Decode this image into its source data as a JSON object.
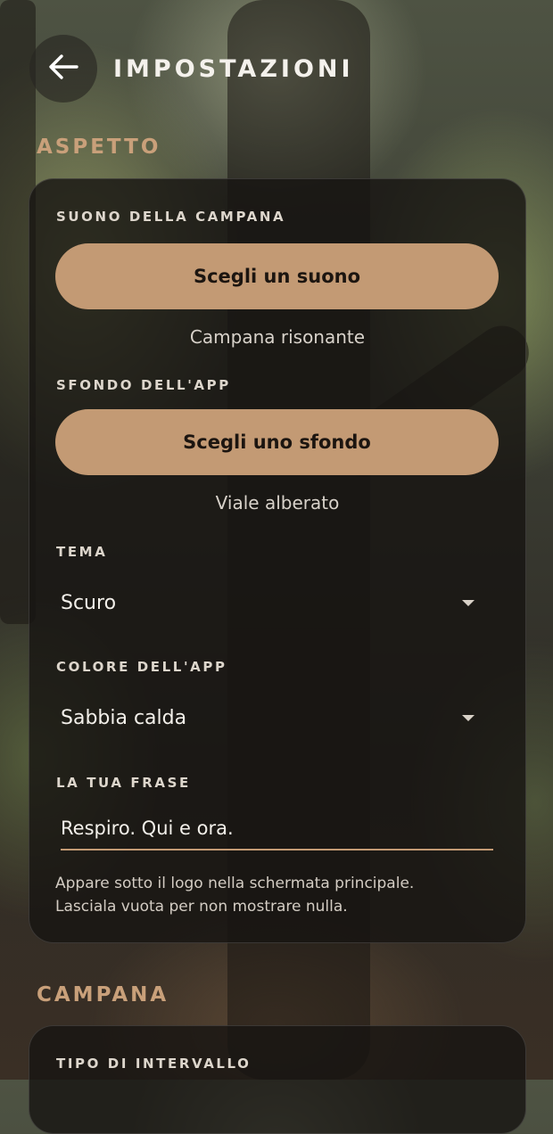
{
  "header": {
    "title": "IMPOSTAZIONI"
  },
  "sections": {
    "aspetto": {
      "title": "ASPETTO",
      "bell_sound": {
        "label": "SUONO DELLA CAMPANA",
        "button": "Scegli un suono",
        "current": "Campana risonante"
      },
      "background": {
        "label": "SFONDO DELL'APP",
        "button": "Scegli uno sfondo",
        "current": "Viale alberato"
      },
      "theme": {
        "label": "TEMA",
        "value": "Scuro"
      },
      "color": {
        "label": "COLORE DELL'APP",
        "value": "Sabbia calda"
      },
      "phrase": {
        "label": "LA TUA FRASE",
        "value": "Respiro. Qui e ora.",
        "helper_line1": "Appare sotto il logo nella schermata principale.",
        "helper_line2": "Lasciala vuota per non mostrare nulla."
      }
    },
    "campana": {
      "title": "CAMPANA",
      "interval_type": {
        "label": "TIPO DI INTERVALLO"
      }
    }
  },
  "colors": {
    "accent": "#c39a74",
    "section_title": "#c9a07a",
    "card_bg": "#161412"
  }
}
